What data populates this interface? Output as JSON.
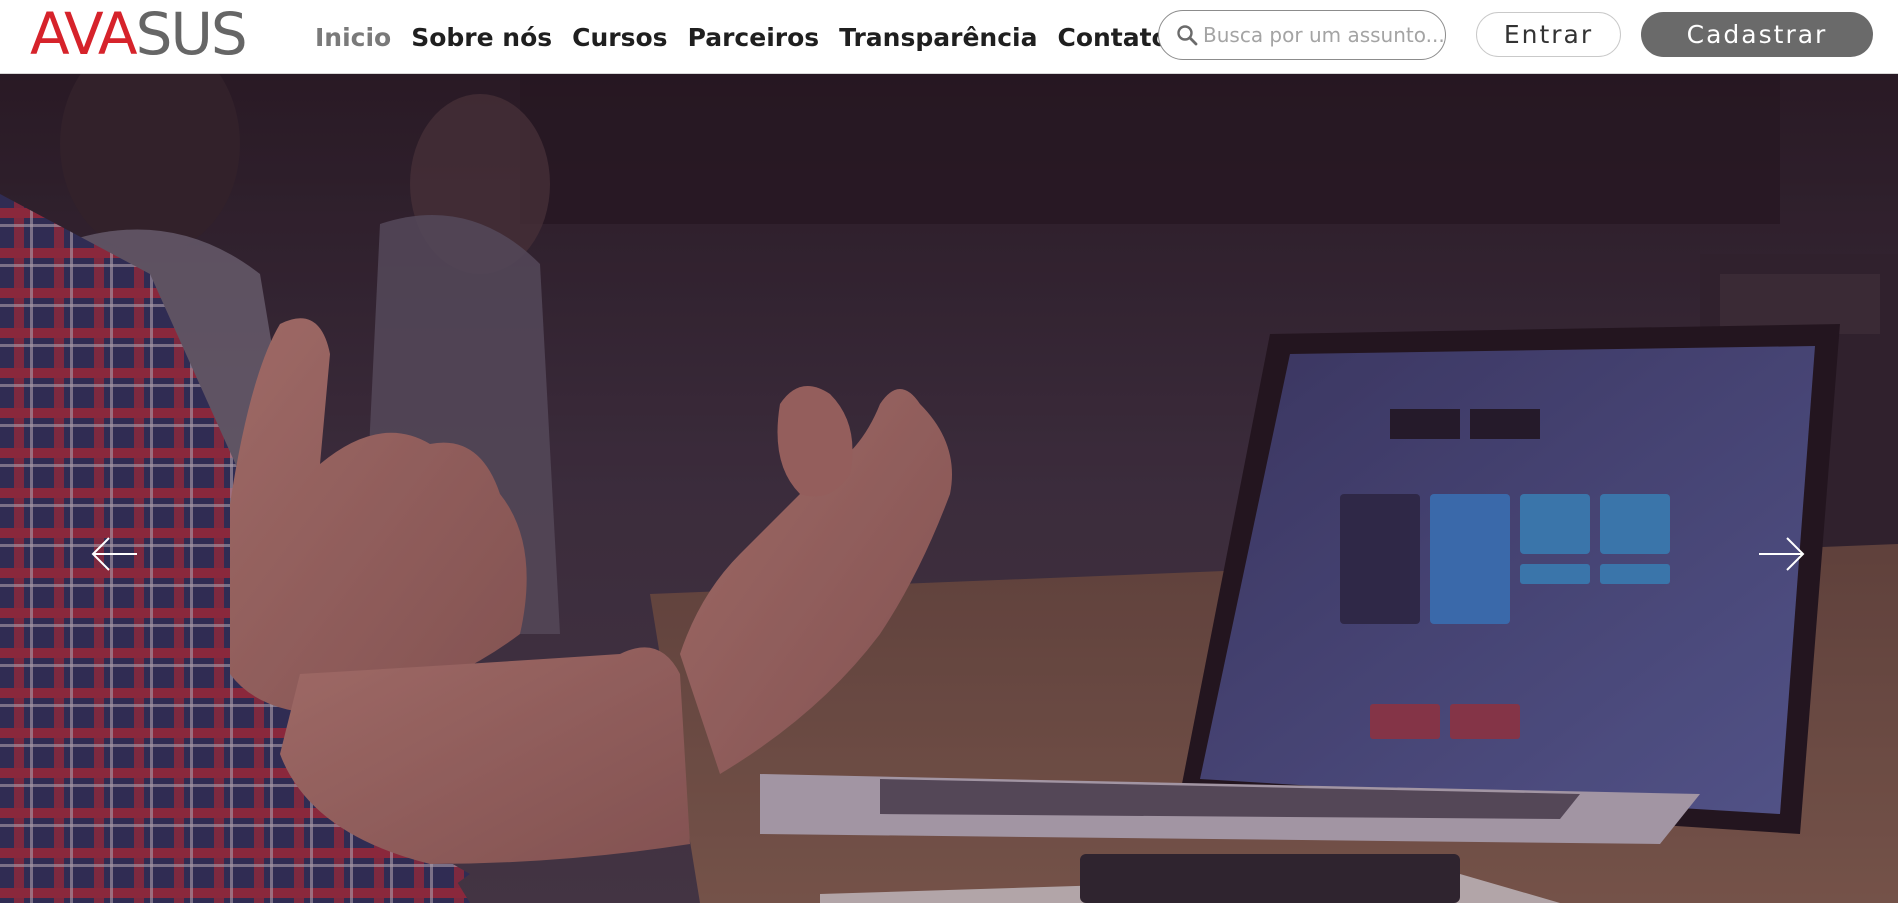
{
  "brand": {
    "logo_ava": "AVA",
    "logo_sus": "SUS"
  },
  "nav": {
    "items": [
      {
        "label": "Inicio",
        "active": true
      },
      {
        "label": "Sobre nós",
        "active": false
      },
      {
        "label": "Cursos",
        "active": false
      },
      {
        "label": "Parceiros",
        "active": false
      },
      {
        "label": "Transparência",
        "active": false
      },
      {
        "label": "Contato",
        "active": false
      }
    ]
  },
  "search": {
    "placeholder": "Busca por um assunto...",
    "icon": "search-icon"
  },
  "auth": {
    "login_label": "Entrar",
    "signup_label": "Cadastrar"
  },
  "carousel": {
    "prev_icon": "arrow-left-icon",
    "next_icon": "arrow-right-icon"
  },
  "colors": {
    "brand_red": "#d6232b",
    "brand_gray": "#666666",
    "signup_bg": "#6a6a6a"
  }
}
